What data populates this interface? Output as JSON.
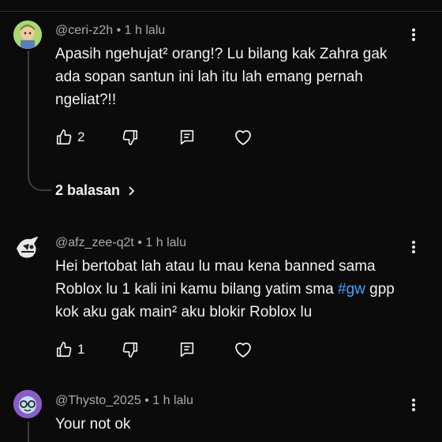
{
  "comments": [
    {
      "handle": "@ceri-z2h",
      "time": "1 h lalu",
      "separator": "•",
      "text": "Apasih ngehujat² orang!? Lu bilang kak Zahra gak ada sopan santun ini lah itu lah emang pernah ngeliat?!!",
      "likes": "2",
      "replies_label": "2 balasan"
    },
    {
      "handle": "@afz_zee-q2t",
      "time": "1 h lalu",
      "separator": "•",
      "text_before": "Hei bertobat lah atau lu mau kena banned sama Roblox lu 1 kali ini kamu bilang yatim sma ",
      "hashtag": "#gw",
      "text_after": " gpp kok aku gak main² aku blokir Roblox lu",
      "likes": "1"
    },
    {
      "handle": "@Thysto_2025",
      "time": "1 h lalu",
      "separator": "•",
      "text": "Your not ok"
    }
  ],
  "colors": {
    "background": "#0b0b0b",
    "text": "#f1f1f1",
    "meta": "#aaaaaa",
    "hashtag": "#3ea6ff"
  },
  "icons": [
    "like-icon",
    "dislike-icon",
    "reply-icon",
    "heart-icon",
    "more-vert-icon",
    "chevron-right-icon"
  ]
}
